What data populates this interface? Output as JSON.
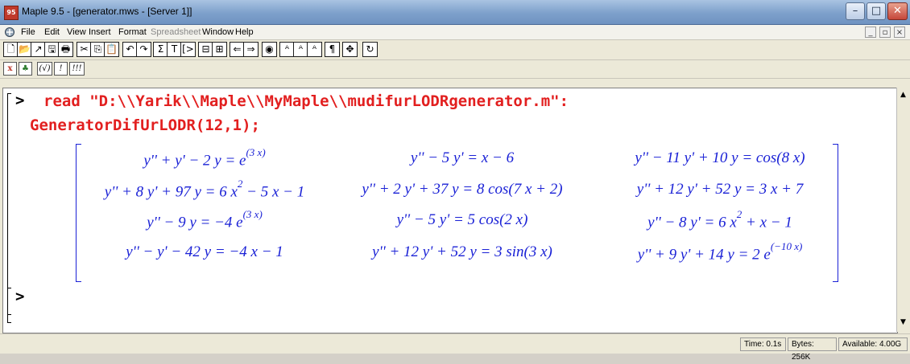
{
  "window": {
    "title": "Maple 9.5 - [generator.mws - [Server 1]]",
    "app_icon_text": "95",
    "buttons": {
      "minimize": "–",
      "maximize": "□",
      "close": "✕"
    }
  },
  "menubar": {
    "items": [
      {
        "label": "File",
        "disabled": false
      },
      {
        "label": "Edit",
        "disabled": false
      },
      {
        "label": "View",
        "disabled": false
      },
      {
        "label": "Insert",
        "disabled": false
      },
      {
        "label": "Format",
        "disabled": false
      },
      {
        "label": "Spreadsheet",
        "disabled": true
      },
      {
        "label": "Window",
        "disabled": false
      },
      {
        "label": "Help",
        "disabled": false
      }
    ],
    "mdi_buttons": [
      "_",
      "▫",
      "×"
    ]
  },
  "toolbar": {
    "icons": [
      "new-icon",
      "open-icon",
      "open-url-icon",
      "save-icon",
      "print-icon",
      "cut-icon",
      "copy-icon",
      "paste-icon",
      "undo-icon",
      "redo-icon",
      "sigma-icon",
      "text-icon",
      "prompt-icon",
      "expand-icon",
      "collapse-icon",
      "back-icon",
      "forward-icon",
      "stop-icon",
      "zoom-100-icon",
      "zoom-150-icon",
      "zoom-200-icon",
      "pilcrow-icon",
      "expand-group-icon",
      "restart-icon"
    ],
    "glyphs": [
      "🗋",
      "📂",
      "↗",
      "🖫",
      "🖶",
      "✂",
      "⎘",
      "📋",
      "↶",
      "↷",
      "Σ",
      "T",
      "[>",
      "⊟",
      "⊞",
      "⇐",
      "⇒",
      "◉",
      "ᴬ",
      "ᴬ",
      "ᴬ",
      "¶",
      "✥",
      "↻"
    ]
  },
  "toolbar2": {
    "buttons": [
      "x",
      "♣",
      "(√)",
      "!",
      "!!!"
    ]
  },
  "worksheet": {
    "prompt_symbol": ">",
    "input_line1": "read \"D:\\\\Yarik\\\\Maple\\\\MyMaple\\\\mudifurLODRgenerator.m\":",
    "input_line2": "GeneratorDifUrLODR(12,1);",
    "matrix": [
      [
        "y'' + y' − 2 y = e^(3 x)",
        "y'' − 5 y' = x − 6",
        "y'' − 11 y' + 10 y = cos(8 x)"
      ],
      [
        "y'' + 8 y' + 97 y = 6 x^2 − 5 x − 1",
        "y'' + 2 y' + 37 y = 8 cos(7 x + 2)",
        "y'' + 12 y' + 52 y = 3 x + 7"
      ],
      [
        "y'' − 9 y = −4 e^(3 x)",
        "y'' − 5 y' = 5 cos(2 x)",
        "y'' − 8 y' = 6 x^2 + x − 1"
      ],
      [
        "y'' − y' − 42 y = −4 x − 1",
        "y'' + 12 y' + 52 y = 3 sin(3 x)",
        "y'' + 9 y' + 14 y = 2 e^(−10 x)"
      ]
    ]
  },
  "statusbar": {
    "time": "Time: 0.1s",
    "bytes": "Bytes: 256K",
    "available": "Available: 4.00G"
  }
}
